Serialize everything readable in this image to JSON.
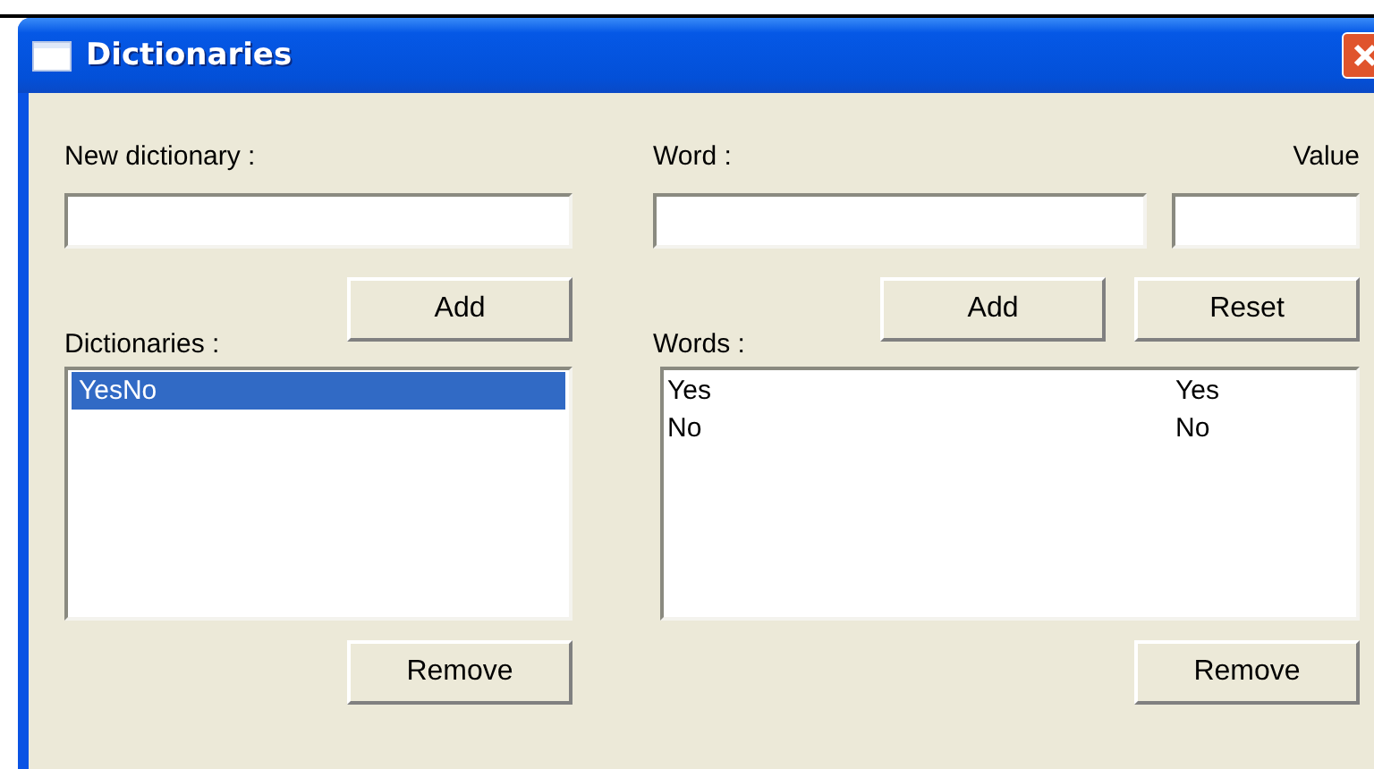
{
  "window": {
    "title": "Dictionaries"
  },
  "new_dictionary": {
    "label": "New dictionary :",
    "add_button": "Add"
  },
  "dictionaries": {
    "label": "Dictionaries :",
    "items": [
      {
        "name": "YesNo",
        "selected": true
      }
    ],
    "remove_button": "Remove"
  },
  "word": {
    "label": "Word :",
    "value_label": "Value",
    "add_button": "Add",
    "reset_button": "Reset"
  },
  "words": {
    "label": "Words :",
    "items": [
      {
        "word": "Yes",
        "value": "Yes",
        "selected": false
      },
      {
        "word": "No",
        "value": "No",
        "selected": false
      }
    ],
    "remove_button": "Remove"
  }
}
